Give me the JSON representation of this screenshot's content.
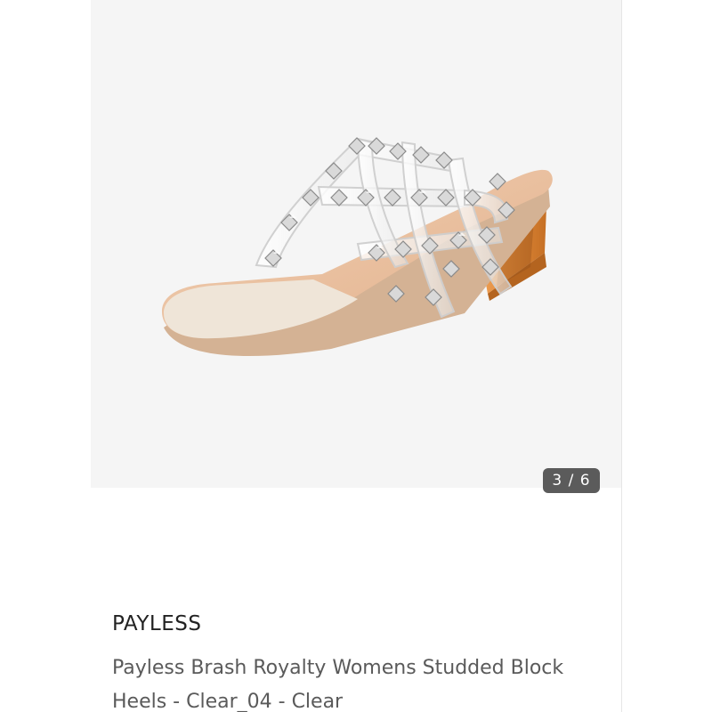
{
  "gallery": {
    "image_icon": "studded-block-heel-sandal",
    "counter": "3 / 6"
  },
  "product": {
    "brand": "PAYLESS",
    "title": "Payless Brash Royalty Womens Studded Block Heels - Clear_04 - Clear"
  },
  "colors": {
    "gallery_background": "#f5f5f5",
    "counter_background": "#5b5b5b",
    "brand_text": "#222222",
    "title_text": "#5a5a5a"
  }
}
